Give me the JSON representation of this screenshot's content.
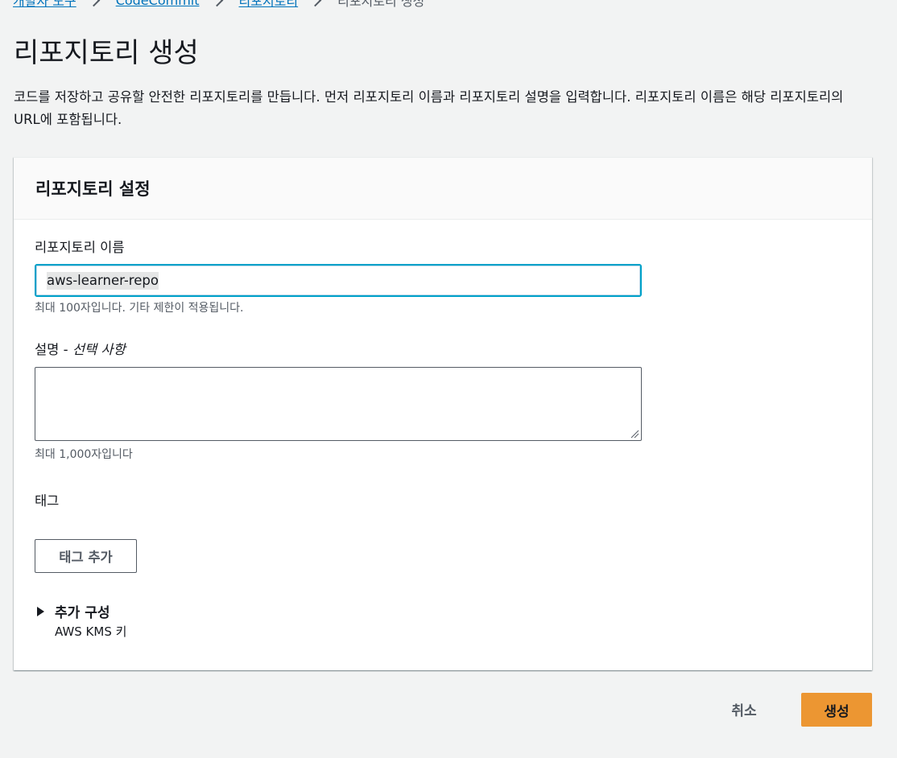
{
  "breadcrumb": {
    "items": [
      "개발자 도구",
      "CodeCommit",
      "리포지토리"
    ],
    "current": "리포지토리 생성"
  },
  "page": {
    "title": "리포지토리 생성",
    "description": "코드를 저장하고 공유할 안전한 리포지토리를 만듭니다. 먼저 리포지토리 이름과 리포지토리 설명을 입력합니다. 리포지토리 이름은 해당 리포지토리의 URL에 포함됩니다."
  },
  "settings": {
    "title": "리포지토리 설정",
    "name_label": "리포지토리 이름",
    "name_value": "aws-learner-repo",
    "name_constraint": "최대 100자입니다. 기타 제한이 적용됩니다.",
    "description_label": "설명 - ",
    "description_optional": "선택 사항",
    "description_value": "",
    "description_constraint": "최대 1,000자입니다",
    "tags_label": "태그",
    "add_tag_button": "태그 추가",
    "additional_config_title": "추가 구성",
    "additional_config_desc": "AWS KMS 키"
  },
  "actions": {
    "cancel": "취소",
    "create": "생성"
  },
  "colors": {
    "link": "#0073bb",
    "primary_button": "#ec9632",
    "focus_border": "#00a1c9",
    "background": "#f2f3f3"
  },
  "icons": [
    "chevron-right-icon",
    "caret-right-icon",
    "resize-handle-icon"
  ]
}
